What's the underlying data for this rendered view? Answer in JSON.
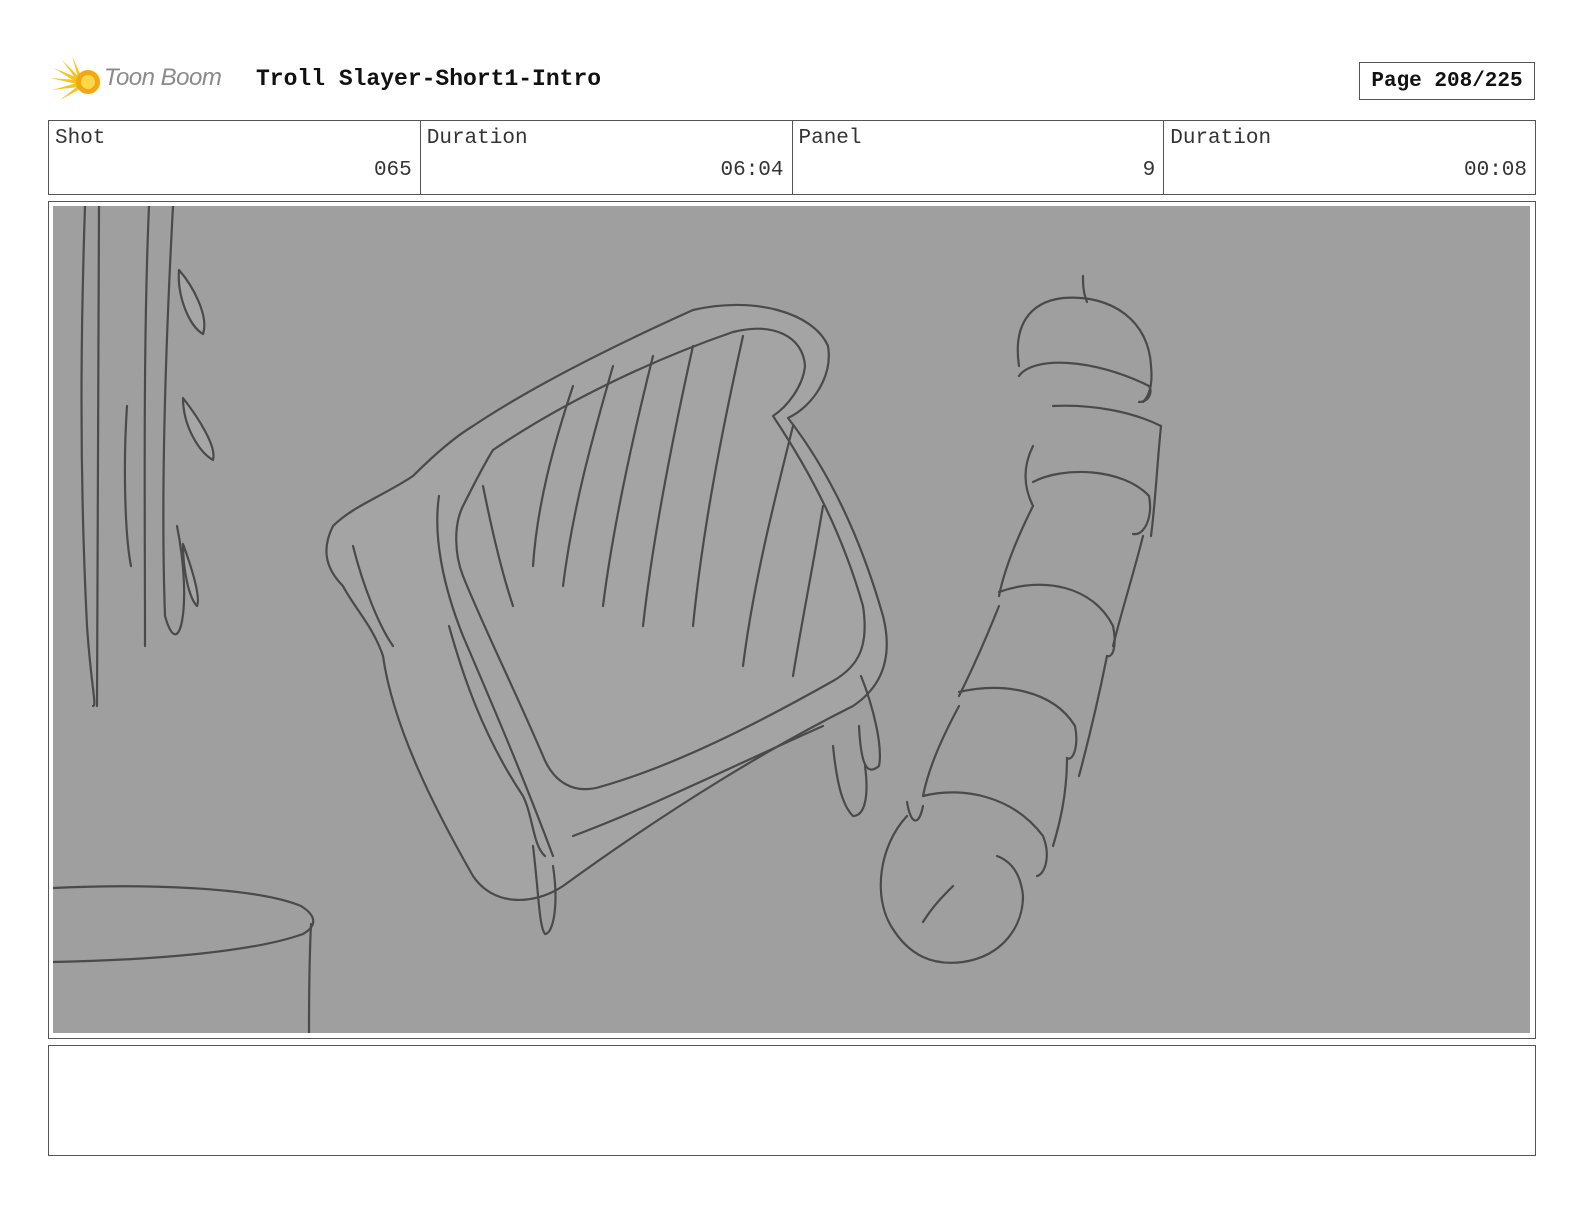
{
  "header": {
    "logo_text": "Toon Boom",
    "title": "Troll Slayer-Short1-Intro",
    "page": "Page 208/225"
  },
  "info": [
    {
      "label": "Shot",
      "value": "065"
    },
    {
      "label": "Duration",
      "value": "06:04"
    },
    {
      "label": "Panel",
      "value": "9"
    },
    {
      "label": "Duration",
      "value": "00:08"
    }
  ],
  "panel": {
    "background_color": "#9f9f9f",
    "line_color": "#4a4a4a"
  },
  "notes": {
    "text": ""
  }
}
